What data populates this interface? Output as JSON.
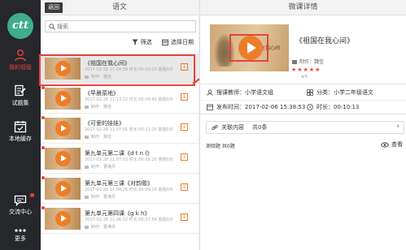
{
  "nav": {
    "logo": "ctt",
    "items": [
      {
        "label": "我的班级",
        "icon": "user-icon",
        "active": true
      },
      {
        "label": "试题集",
        "icon": "test-set-icon",
        "active": false
      },
      {
        "label": "本地缓存",
        "icon": "calendar-check-icon",
        "active": false
      },
      {
        "label": "交流中心",
        "icon": "chat-icon",
        "active": false
      },
      {
        "label": "更多",
        "icon": "more-dots-icon",
        "active": false
      }
    ]
  },
  "middle": {
    "back_label": "返回",
    "title": "语文",
    "search": {
      "placeholder": "搜索",
      "value": ""
    },
    "filter_label": "筛选",
    "date_label": "选择日期",
    "items": [
      {
        "title": "《祖国在我心间》",
        "meta": "2017-02-28 11:04:08  时长:00:10:13  答题0/0",
        "maker": "制作：魏佳",
        "selected": true
      },
      {
        "title": "《早晨菜地》",
        "meta": "2017-02-28 11:13:22  时长:00:08:45  答题0/0",
        "maker": "制作：魏佳",
        "selected": false
      },
      {
        "title": "《可爱的娃娃》",
        "meta": "2017-02-28 11:07:01  时长:00:11:20  答题0/0",
        "maker": "制作：魏佳",
        "selected": false
      },
      {
        "title": "第九单元第二课《d t n l》",
        "meta": "2017-02-28 11:07:02  时长:00:08:25  答题0/0",
        "maker": "制作：曹满月",
        "selected": false
      },
      {
        "title": "第九单元第三课《对韵歌》",
        "meta": "2017-02-28 11:04:26  时长:00:09:16  答题0/0",
        "maker": "制作：曹满月",
        "selected": false
      },
      {
        "title": "第九单元第四课《g k h》",
        "meta": "2017-02-28 11:06:22  时长:00:07:54  答题0/0",
        "maker": "制作：曹满月",
        "selected": false
      }
    ]
  },
  "detail": {
    "header": "微课详情",
    "cover_text": "祖国在我心间",
    "title": "《祖国在我心间》",
    "maker": "制作：魏佳",
    "stars": "★★★★★",
    "rating_count": "4/5",
    "teacher": "搜课教师：小学语文组",
    "category": "分类：小学二年级语文",
    "published": "发布时间：2017-02-06 15:38:53",
    "duration": "时长：00:10:13",
    "related_label": "关联内容",
    "related_count": "共0条",
    "quiz_label": "测验题 共0题",
    "view_label": "查看"
  },
  "colors": {
    "accent": "#ee7d28",
    "highlight": "#e8433c",
    "nav_bg": "#26272b"
  }
}
